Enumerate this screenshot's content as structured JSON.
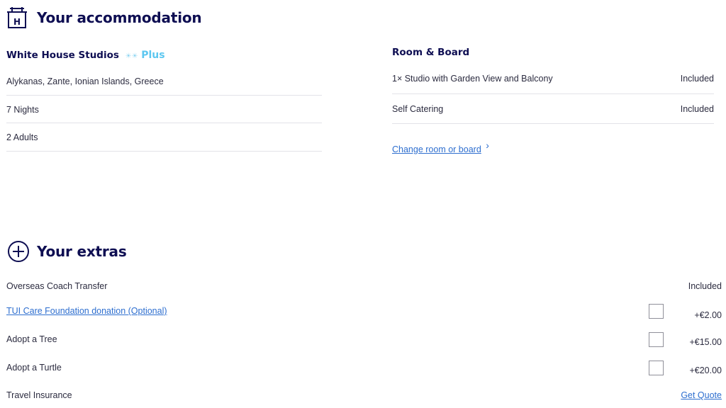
{
  "accommodation": {
    "heading": "Your accommodation",
    "hotel_name": "White House Studios",
    "rating_symbols": "☀☀",
    "plus_label": "Plus",
    "details": [
      {
        "text": "Alykanas, Zante, Ionian Islands, Greece"
      },
      {
        "text": "7 Nights"
      },
      {
        "text": "2  Adults"
      }
    ]
  },
  "room_board": {
    "heading": "Room & Board",
    "rows": [
      {
        "label": "1× Studio with Garden View and Balcony",
        "status": "Included"
      },
      {
        "label": "Self Catering",
        "status": "Included"
      }
    ],
    "change_link": "Change room or board",
    "change_chevron": "›"
  },
  "extras": {
    "heading": "Your extras",
    "items": [
      {
        "label": "Overseas Coach Transfer",
        "value": "Included"
      },
      {
        "label": "TUI Care Foundation donation (Optional)",
        "value": "+€2.00"
      },
      {
        "label": "Adopt a Tree",
        "value": "+€15.00"
      },
      {
        "label": "Adopt a Turtle",
        "value": "+€20.00"
      },
      {
        "label": "Travel Insurance",
        "value": "Get Quote"
      }
    ]
  },
  "icons": {
    "hotel": "hotel-icon",
    "add": "add-circle-icon",
    "chevron": "chevron-right-icon"
  },
  "colors": {
    "heading": "#0e0e52",
    "link": "#2d6ecf",
    "plus": "#5cc7f0",
    "divider": "#e2e2e8"
  }
}
